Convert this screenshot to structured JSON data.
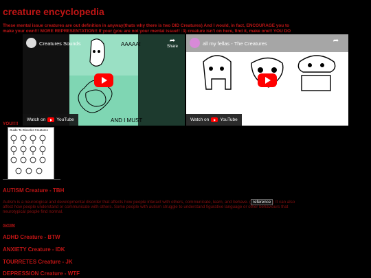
{
  "page": {
    "title": "creature encyclopedia",
    "intro_line1": "These mental issue creatures are out definition in anyway(thats why there is two DID Creatures) And I would, in fact, ENCOURAGE you to",
    "intro_line2": "make your own!!! MORE REPRESENTATION!! If your (you are not your mental issue!! :3) creature isn't on here, find it, make one!! YOU DO",
    "intro_line3": "YOU!!!!"
  },
  "videos": [
    {
      "title": "Creatures Sounds",
      "share_label": "Share",
      "watch_label": "Watch on",
      "logo_label": "YouTube",
      "thumb_text1": "AAAAA!",
      "thumb_text2": "AND I MUST"
    },
    {
      "title": "all my fellas - The Creatures",
      "share_label": "Share",
      "watch_label": "Watch on",
      "logo_label": "YouTube"
    }
  ],
  "guide_image": {
    "title": "Guide To Disorder Creatures"
  },
  "sections": [
    {
      "heading": "AUTISM Creature - TBH",
      "body_line1": "Autism is a neurological and developmental disorder that affects how people interact with others, communicate, learn, and behave. (",
      "reference": "reference",
      "body_line1_end": ") It can also",
      "body_line2": "affect how people understand or communicate with others. Some people with autism struggle to understand figurative language or other behaviours that",
      "body_line3": "neurotypical people find normal.",
      "tag": "AUTISM"
    },
    {
      "heading": "ADHD Creature - BTW"
    },
    {
      "heading": "ANXIETY Creature - IDK"
    },
    {
      "heading": "TOURRETES Creature - JK"
    },
    {
      "heading": "DEPRESSION Creature - WTF"
    }
  ],
  "colors": {
    "background": "#000000",
    "accent_red": "#c01515",
    "youtube_red": "#ff0000"
  }
}
